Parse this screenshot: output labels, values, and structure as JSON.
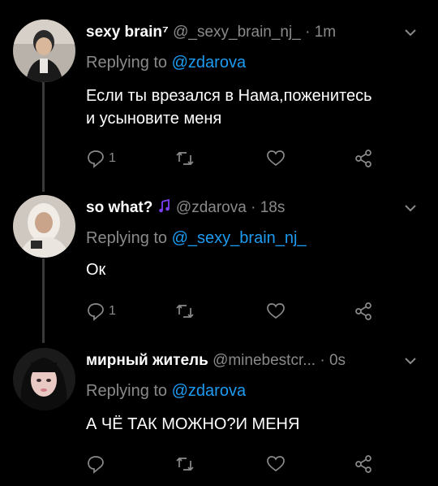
{
  "colors": {
    "background": "#000000",
    "text": "#ffffff",
    "muted": "#8a8a8a",
    "mention": "#1d9bf0",
    "note": "#7b3ff2"
  },
  "tweets": [
    {
      "name": "sexy brain⁷",
      "handle": "@_sexy_brain_nj_",
      "sep": "·",
      "time": "1m",
      "replying_label": "Replying to",
      "replying_to": "@zdarova",
      "text_lines": [
        "Если ты врезался в Нама,поженитесь",
        "и усыновите меня"
      ],
      "reply_count": "1"
    },
    {
      "name": "so what?",
      "handle": "@zdarova",
      "sep": "·",
      "time": "18s",
      "replying_label": "Replying to",
      "replying_to": "@_sexy_brain_nj_",
      "text_lines": [
        "Ок"
      ],
      "reply_count": "1"
    },
    {
      "name": "мирный житель",
      "handle": "@minebestcr...",
      "sep": "·",
      "time": "0s",
      "replying_label": "Replying to",
      "replying_to": "@zdarova",
      "text_lines": [
        "А ЧЁ ТАК МОЖНО?И МЕНЯ"
      ],
      "reply_count": ""
    }
  ],
  "icons": [
    "reply-icon",
    "retweet-icon",
    "like-icon",
    "share-icon",
    "chevron-down-icon",
    "music-note-icon"
  ]
}
